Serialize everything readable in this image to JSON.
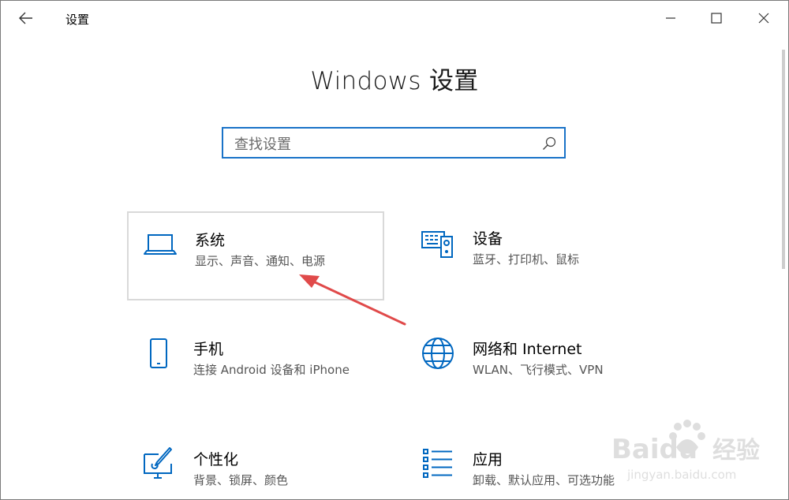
{
  "window": {
    "title": "设置"
  },
  "titlebar": {
    "back": "back-arrow-icon",
    "minimize": "minimize-icon",
    "maximize": "maximize-icon",
    "close": "close-icon"
  },
  "page": {
    "title": "Windows 设置"
  },
  "search": {
    "placeholder": "查找设置",
    "icon": "search-icon"
  },
  "categories": [
    {
      "title": "系统",
      "desc": "显示、声音、通知、电源",
      "icon": "laptop-icon",
      "selected": true
    },
    {
      "title": "设备",
      "desc": "蓝牙、打印机、鼠标",
      "icon": "keyboard-speaker-icon"
    },
    {
      "title": "手机",
      "desc": "连接 Android 设备和 iPhone",
      "icon": "phone-icon"
    },
    {
      "title": "网络和 Internet",
      "desc": "WLAN、飞行模式、VPN",
      "icon": "globe-icon"
    },
    {
      "title": "个性化",
      "desc": "背景、锁屏、颜色",
      "icon": "paint-monitor-icon"
    },
    {
      "title": "应用",
      "desc": "卸载、默认应用、可选功能",
      "icon": "app-list-icon"
    }
  ],
  "colors": {
    "accent": "#0067c0",
    "annotation_arrow": "#e04a4a",
    "search_border": "#1a73c8"
  },
  "watermark": {
    "brand": "Baidu",
    "brand_cn": "经验",
    "url": "jingyan.baidu.com"
  }
}
